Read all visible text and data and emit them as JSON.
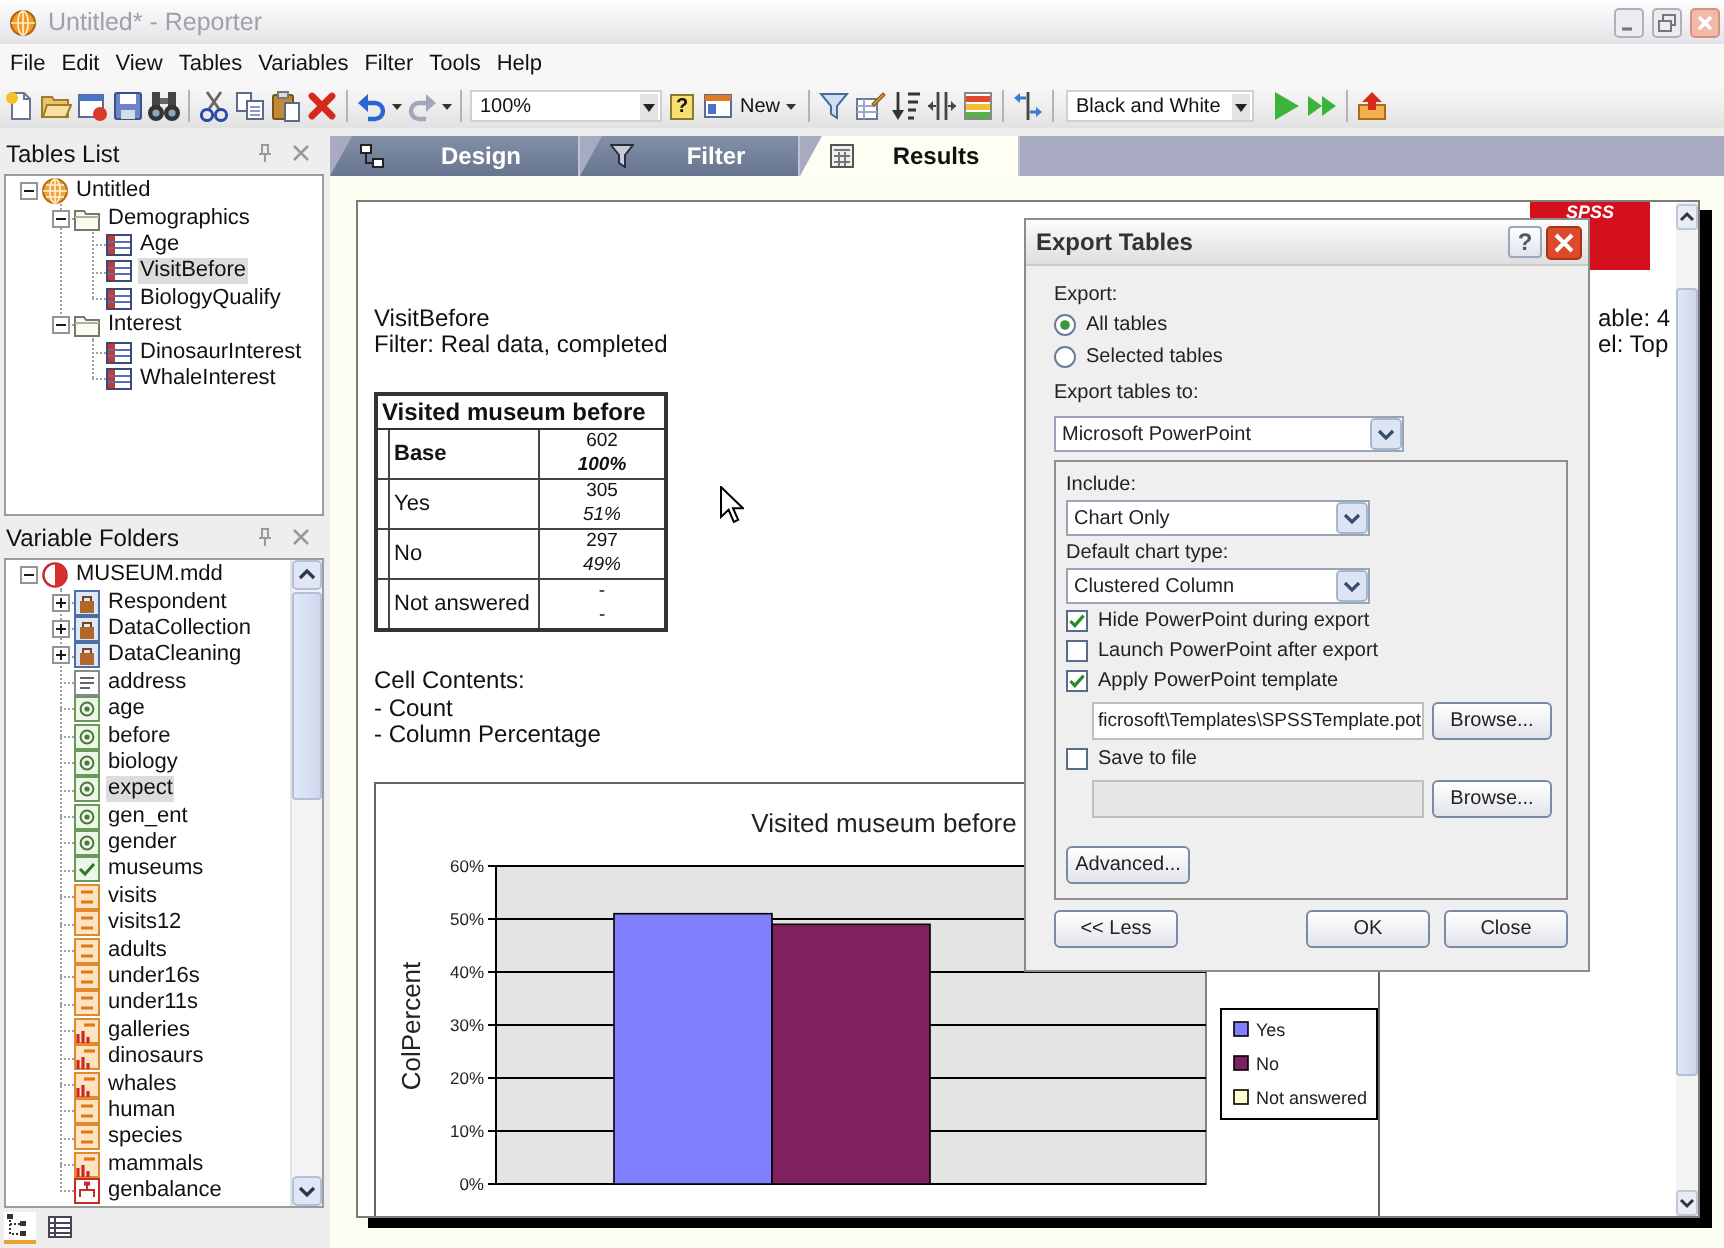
{
  "window": {
    "title": "Untitled* - Reporter",
    "active": false
  },
  "menu": [
    "File",
    "Edit",
    "View",
    "Tables",
    "Variables",
    "Filter",
    "Tools",
    "Help"
  ],
  "toolbar": {
    "zoom": "100%",
    "help_glyph": "?",
    "new_button": "New",
    "color_scheme": "Black and White"
  },
  "tables_panel": {
    "title": "Tables List",
    "tree": [
      {
        "label": "Untitled",
        "kind": "document",
        "expanded": true,
        "selected": false,
        "children": [
          {
            "label": "Demographics",
            "kind": "folder",
            "expanded": true,
            "selected": false,
            "children": [
              {
                "label": "Age",
                "kind": "table",
                "selected": false
              },
              {
                "label": "VisitBefore",
                "kind": "table",
                "selected": true
              },
              {
                "label": "BiologyQualify",
                "kind": "table",
                "selected": false
              }
            ]
          },
          {
            "label": "Interest",
            "kind": "folder",
            "expanded": true,
            "selected": false,
            "children": [
              {
                "label": "DinosaurInterest",
                "kind": "table",
                "selected": false
              },
              {
                "label": "WhaleInterest",
                "kind": "table",
                "selected": false
              }
            ]
          }
        ]
      }
    ]
  },
  "variables_panel": {
    "title": "Variable Folders",
    "tree": [
      {
        "label": "MUSEUM.mdd",
        "kind": "source",
        "expanded": true,
        "selected": false,
        "children": [
          {
            "label": "Respondent",
            "kind": "group",
            "expanded": false,
            "selected": false
          },
          {
            "label": "DataCollection",
            "kind": "group",
            "expanded": false,
            "selected": false
          },
          {
            "label": "DataCleaning",
            "kind": "group",
            "expanded": false,
            "selected": false
          },
          {
            "label": "address",
            "kind": "text",
            "selected": false
          },
          {
            "label": "age",
            "kind": "categorical",
            "selected": false
          },
          {
            "label": "before",
            "kind": "categorical",
            "selected": false
          },
          {
            "label": "biology",
            "kind": "categorical",
            "selected": false
          },
          {
            "label": "expect",
            "kind": "categorical",
            "selected": true
          },
          {
            "label": "gen_ent",
            "kind": "categorical",
            "selected": false
          },
          {
            "label": "gender",
            "kind": "categorical",
            "selected": false
          },
          {
            "label": "museums",
            "kind": "multi",
            "selected": false
          },
          {
            "label": "visits",
            "kind": "numeric",
            "selected": false
          },
          {
            "label": "visits12",
            "kind": "numeric",
            "selected": false
          },
          {
            "label": "adults",
            "kind": "numeric",
            "selected": false
          },
          {
            "label": "under16s",
            "kind": "numeric",
            "selected": false
          },
          {
            "label": "under11s",
            "kind": "numeric",
            "selected": false
          },
          {
            "label": "galleries",
            "kind": "derived",
            "selected": false
          },
          {
            "label": "dinosaurs",
            "kind": "derived",
            "selected": false
          },
          {
            "label": "whales",
            "kind": "derived",
            "selected": false
          },
          {
            "label": "human",
            "kind": "numeric",
            "selected": false
          },
          {
            "label": "species",
            "kind": "numeric",
            "selected": false
          },
          {
            "label": "mammals",
            "kind": "derived",
            "selected": false
          },
          {
            "label": "genbalance",
            "kind": "grid",
            "selected": false
          }
        ]
      }
    ]
  },
  "panel_tabs": [
    {
      "kind": "tree",
      "selected": true
    },
    {
      "kind": "list",
      "selected": false
    }
  ],
  "view_tabs": [
    {
      "label": "Design",
      "kind": "design",
      "selected": false
    },
    {
      "label": "Filter",
      "kind": "filter",
      "selected": false
    },
    {
      "label": "Results",
      "kind": "results",
      "selected": true
    }
  ],
  "results": {
    "logo": "SPSS",
    "heading": "VisitBefore",
    "filter": "Filter: Real data, completed",
    "side_notes": [
      "able: 4",
      "el: Top"
    ],
    "table": {
      "title": "Visited museum before",
      "rows": [
        {
          "kind": "base",
          "label": "Base",
          "count": "602",
          "percent": "100%"
        },
        {
          "kind": "category",
          "label": "Yes",
          "count": "305",
          "percent": "51%"
        },
        {
          "kind": "category",
          "label": "No",
          "count": "297",
          "percent": "49%"
        },
        {
          "kind": "category",
          "label": "Not answered",
          "count": "-",
          "percent": "-"
        }
      ]
    },
    "cell_contents": [
      "Cell Contents:",
      "- Count",
      "- Column Percentage"
    ],
    "chart": {
      "chart_data": {
        "type": "bar",
        "title": "Visited museum before",
        "ylabel": "ColPercent",
        "ylim": [
          0,
          60
        ],
        "yticks": [
          {
            "value": 0,
            "label": "0%"
          },
          {
            "value": 10,
            "label": "10%"
          },
          {
            "value": 20,
            "label": "20%"
          },
          {
            "value": 30,
            "label": "30%"
          },
          {
            "value": 40,
            "label": "40%"
          },
          {
            "value": 50,
            "label": "50%"
          },
          {
            "value": 60,
            "label": "60%"
          }
        ],
        "grid": true,
        "legend": "right",
        "series": [
          {
            "name": "Yes",
            "color": "#8080ff",
            "values": [
              51
            ]
          },
          {
            "name": "No",
            "color": "#802060",
            "values": [
              49
            ]
          },
          {
            "name": "Not answered",
            "color": "#ffffcc",
            "values": [
              null
            ]
          }
        ]
      }
    }
  },
  "export_dialog": {
    "title": "Export Tables",
    "help_button": "?",
    "export_label": "Export:",
    "export_scope": [
      {
        "label": "All tables",
        "selected": true
      },
      {
        "label": "Selected tables",
        "selected": false
      }
    ],
    "target_label": "Export tables to:",
    "target": "Microsoft PowerPoint",
    "include_label": "Include:",
    "include": "Chart Only",
    "chart_type_label": "Default chart type:",
    "chart_type": "Clustered Column",
    "options": [
      {
        "label": "Hide PowerPoint during export",
        "checked": true
      },
      {
        "label": "Launch PowerPoint after export",
        "checked": false
      },
      {
        "label": "Apply PowerPoint template",
        "checked": true
      }
    ],
    "template_path": "ficrosoft\\Templates\\SPSSTemplate.pot",
    "template_browse": "Browse...",
    "save_to_file": {
      "label": "Save to file",
      "checked": false
    },
    "save_path": {
      "disabled": true
    },
    "save_browse": "Browse...",
    "advanced_button": "Advanced...",
    "less_button": "<< Less",
    "ok_button": "OK",
    "close_button": "Close"
  }
}
